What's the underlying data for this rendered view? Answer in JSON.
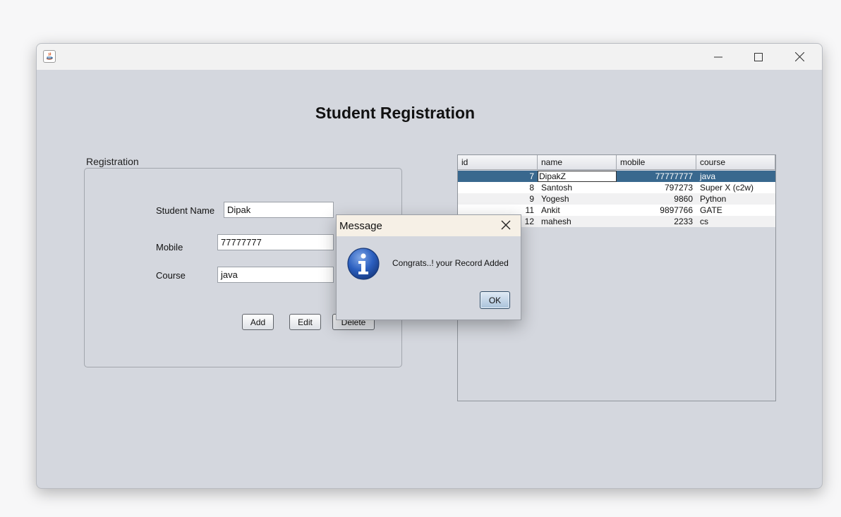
{
  "window": {
    "title_icon": "java-icon",
    "controls": [
      "minimize-icon",
      "maximize-icon",
      "close-icon"
    ]
  },
  "heading": "Student Registration",
  "registration": {
    "group_label": "Registration",
    "student_name_label": "Student Name",
    "student_name_value": "Dipak",
    "mobile_label": "Mobile",
    "mobile_value": "77777777",
    "course_label": "Course",
    "course_value": "java",
    "buttons": {
      "add": "Add",
      "edit": "Edit",
      "delete": "Delete"
    }
  },
  "table": {
    "columns": [
      "id",
      "name",
      "mobile",
      "course"
    ],
    "rows": [
      {
        "id": "7",
        "name": "DipakZ",
        "mobile": "77777777",
        "course": "java"
      },
      {
        "id": "8",
        "name": "Santosh",
        "mobile": "797273",
        "course": "Super X (c2w)"
      },
      {
        "id": "9",
        "name": "Yogesh",
        "mobile": "9860",
        "course": "Python"
      },
      {
        "id": "11",
        "name": "Ankit",
        "mobile": "9897766",
        "course": "GATE"
      },
      {
        "id": "12",
        "name": "mahesh",
        "mobile": "2233",
        "course": "cs"
      }
    ],
    "selected_row": 0
  },
  "dialog": {
    "title": "Message",
    "message": "Congrats..! your Record Added",
    "ok_label": "OK",
    "icon": "info-icon"
  },
  "colors": {
    "window_bg": "#d4d7de",
    "selected_row": "#39688e"
  }
}
